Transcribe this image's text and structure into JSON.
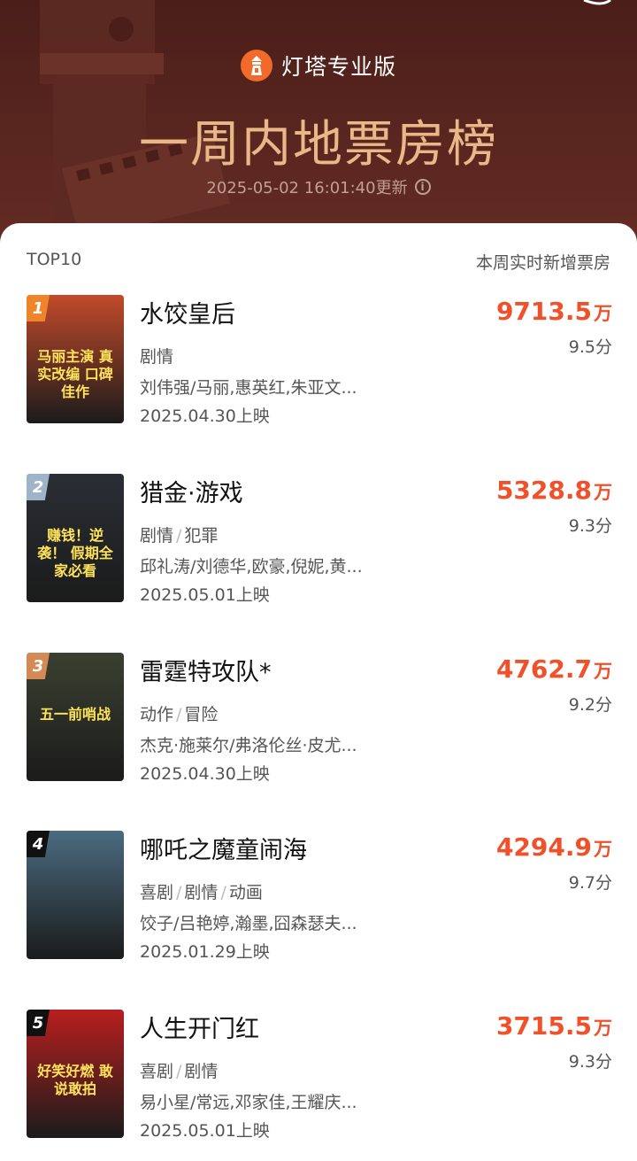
{
  "header": {
    "brand": "灯塔专业版",
    "title": "一周内地票房榜",
    "updated": "2025-05-02 16:01:40更新"
  },
  "list": {
    "left_label": "TOP10",
    "right_label": "本周实时新增票房",
    "unit": "万",
    "items": [
      {
        "rank": "1",
        "title": "水饺皇后",
        "genres": [
          "剧情"
        ],
        "cast": "刘伟强/马丽,惠英红,朱亚文...",
        "release": "2025.04.30上映",
        "box": "9713.5",
        "score": "9.5分",
        "rank_color": "#f0842a",
        "poster_text": "马丽主演 真实改编 口碑佳作",
        "poster_bg": "#c24a2a"
      },
      {
        "rank": "2",
        "title": "猎金·游戏",
        "genres": [
          "剧情",
          "犯罪"
        ],
        "cast": "邱礼涛/刘德华,欧豪,倪妮,黄...",
        "release": "2025.05.01上映",
        "box": "5328.8",
        "score": "9.3分",
        "rank_color": "#9fb4c8",
        "poster_text": "赚钱！逆袭！ 假期全家必看",
        "poster_bg": "#2a2e35"
      },
      {
        "rank": "3",
        "title": "雷霆特攻队*",
        "genres": [
          "动作",
          "冒险"
        ],
        "cast": "杰克·施莱尔/弗洛伦丝·皮尤...",
        "release": "2025.04.30上映",
        "box": "4762.7",
        "score": "9.2分",
        "rank_color": "#d48a54",
        "poster_text": "五一前哨战",
        "poster_bg": "#3a4030"
      },
      {
        "rank": "4",
        "title": "哪吒之魔童闹海",
        "genres": [
          "喜剧",
          "剧情",
          "动画"
        ],
        "cast": "饺子/吕艳婷,瀚墨,囧森瑟夫...",
        "release": "2025.01.29上映",
        "box": "4294.9",
        "score": "9.7分",
        "rank_color": "#111111",
        "poster_text": "",
        "poster_bg": "#4a6b80"
      },
      {
        "rank": "5",
        "title": "人生开门红",
        "genres": [
          "喜剧",
          "剧情"
        ],
        "cast": "易小星/常远,邓家佳,王耀庆...",
        "release": "2025.05.01上映",
        "box": "3715.5",
        "score": "9.3分",
        "rank_color": "#111111",
        "poster_text": "好笑好燃 敢说敢拍",
        "poster_bg": "#b81f1f"
      }
    ]
  }
}
